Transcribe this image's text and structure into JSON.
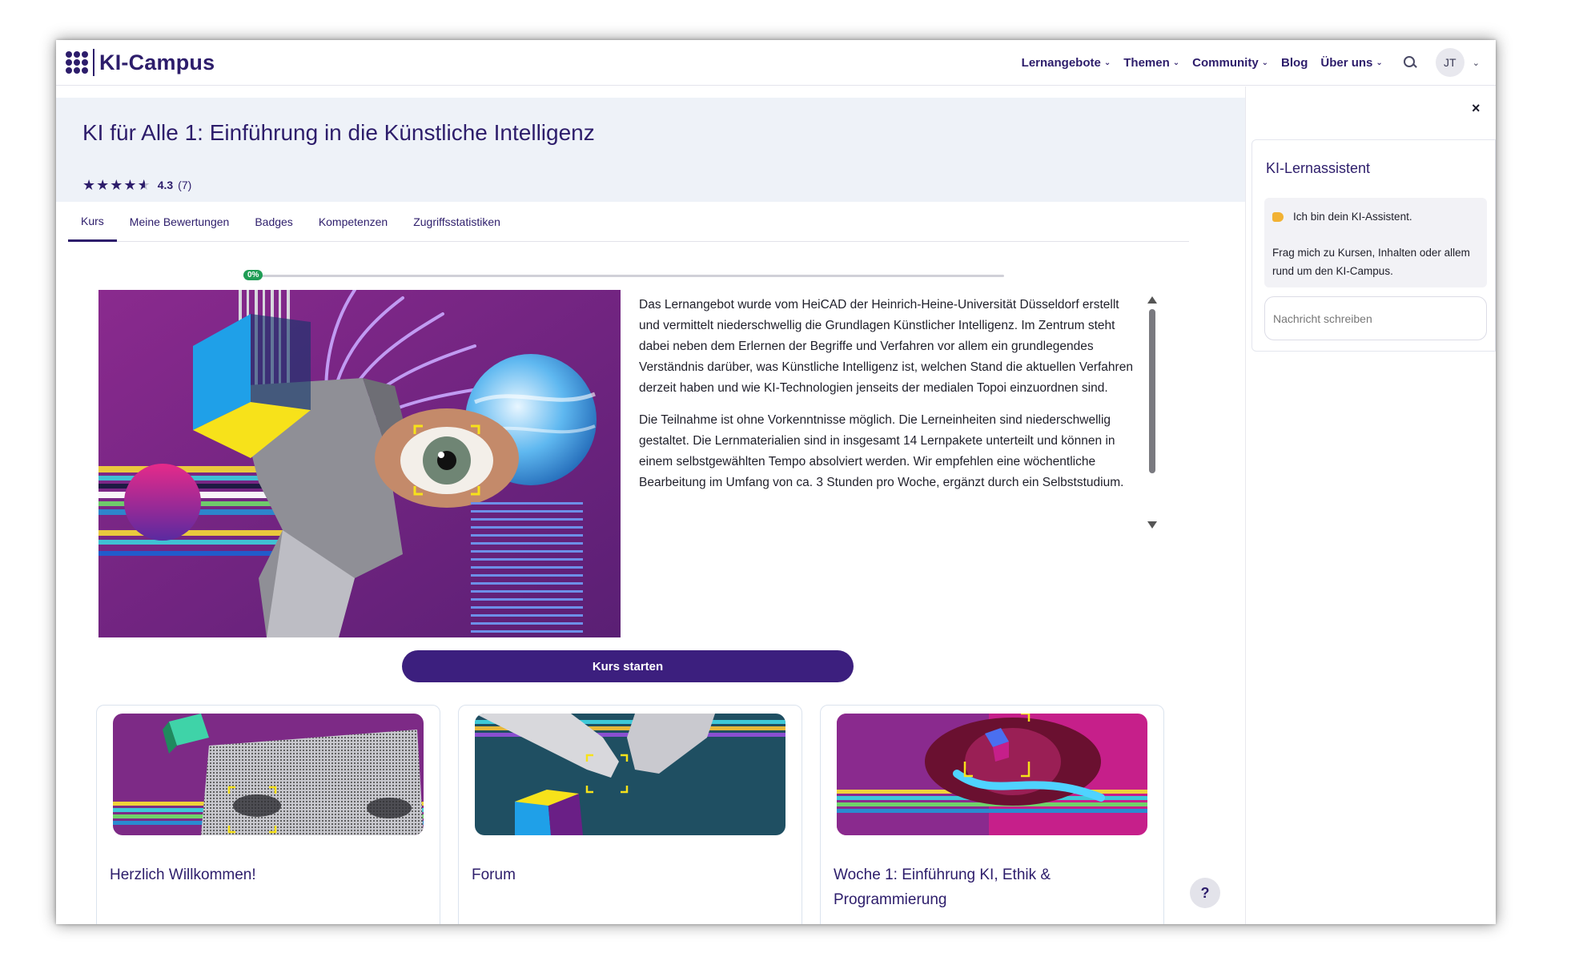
{
  "header": {
    "logo_text": "KI-Campus",
    "nav": [
      {
        "label": "Lernangebote",
        "dropdown": true
      },
      {
        "label": "Themen",
        "dropdown": true
      },
      {
        "label": "Community",
        "dropdown": true
      },
      {
        "label": "Blog",
        "dropdown": false
      },
      {
        "label": "Über uns",
        "dropdown": true
      }
    ],
    "avatar_initials": "JT"
  },
  "course": {
    "title": "KI für Alle 1: Einführung in die Künstliche Intelligenz",
    "rating_value": "4.3",
    "rating_count": "(7)",
    "rating_stars": 4.3,
    "progress_label": "0%",
    "progress_value": 0
  },
  "tabs": [
    {
      "label": "Kurs",
      "active": true
    },
    {
      "label": "Meine Bewertungen",
      "active": false
    },
    {
      "label": "Badges",
      "active": false
    },
    {
      "label": "Kompetenzen",
      "active": false
    },
    {
      "label": "Zugriffsstatistiken",
      "active": false
    }
  ],
  "description": {
    "p1": "Das Lernangebot wurde vom HeiCAD der Heinrich-Heine-Universität Düsseldorf erstellt und vermittelt niederschwellig die Grundlagen Künstlicher Intelligenz. Im Zentrum steht dabei neben dem Erlernen der Begriffe und Verfahren vor allem ein grundlegendes Verständnis darüber, was Künstliche Intelligenz ist, welchen Stand die aktuellen Verfahren derzeit haben und wie KI-Technologien jenseits der medialen Topoi einzuordnen sind.",
    "p2": "Die Teilnahme ist ohne Vorkenntnisse möglich. Die Lerneinheiten sind niederschwellig gestaltet. Die Lernmaterialien sind in insgesamt 14 Lernpakete unterteilt und können in einem selbstgewählten Tempo absolviert werden. Wir empfehlen eine wöchentliche Bearbeitung im Umfang von ca. 3 Stunden pro Woche, ergänzt durch ein Selbststudium."
  },
  "start_button": "Kurs starten",
  "cards": [
    {
      "title": "Herzlich Willkommen!"
    },
    {
      "title": "Forum"
    },
    {
      "title": "Woche 1: Einführung KI, Ethik & Programmierung"
    }
  ],
  "help_label": "?",
  "assistant": {
    "title": "KI-Lernassistent",
    "greeting": "Ich bin dein KI-Assistent.",
    "prompt": "Frag mich zu Kursen, Inhalten oder allem rund um den KI-Campus.",
    "input_placeholder": "Nachricht schreiben",
    "close_label": "×"
  },
  "colors": {
    "brand": "#2d1d6b",
    "button": "#3c1f7e",
    "progress": "#1f9d55",
    "banner": "#eef2f8"
  }
}
